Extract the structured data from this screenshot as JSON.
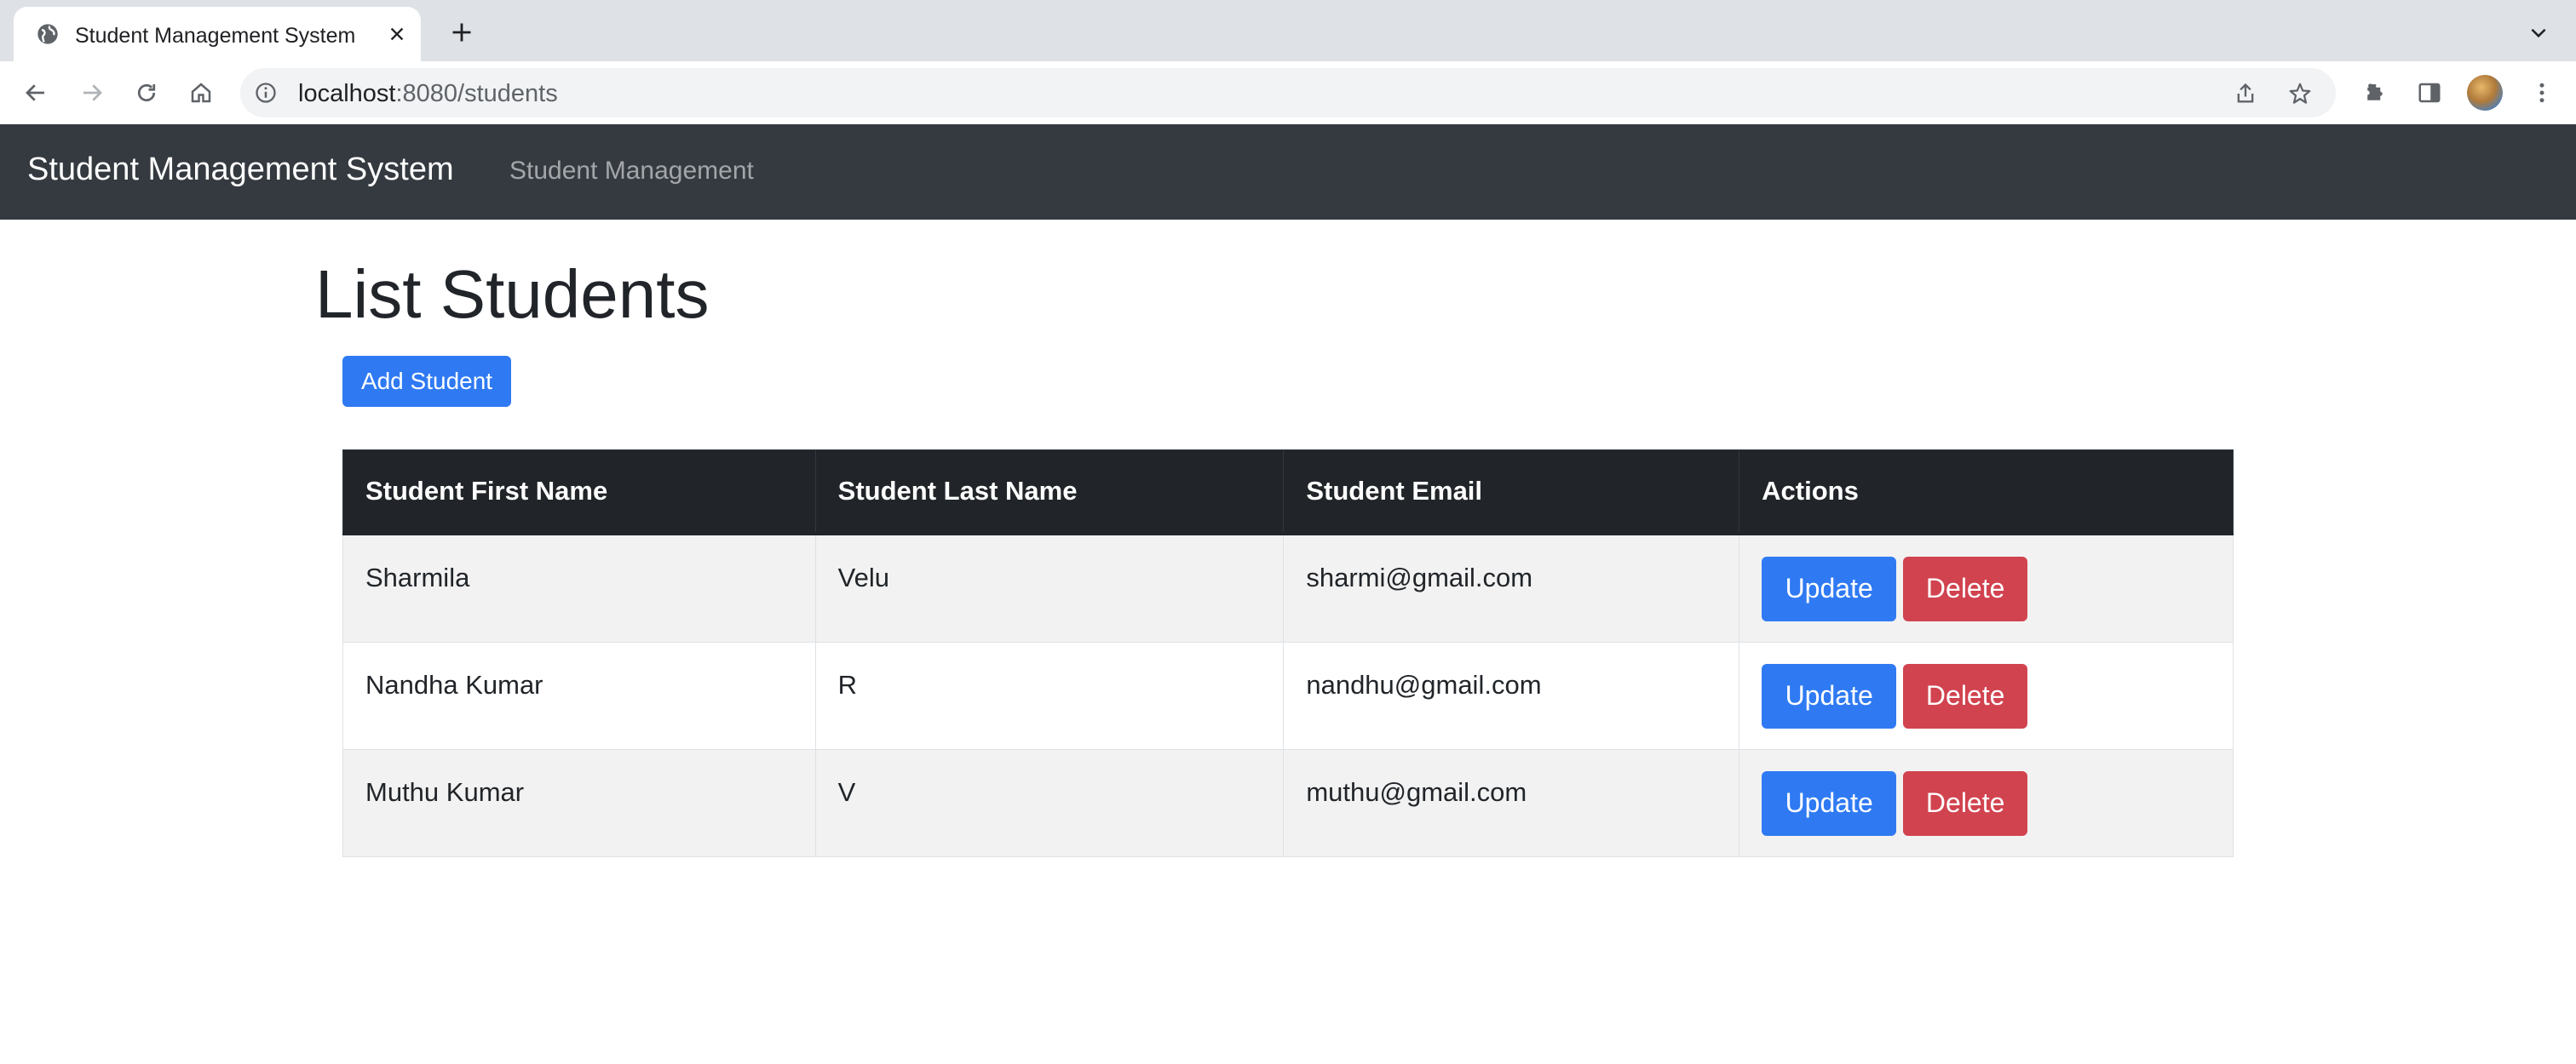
{
  "browser": {
    "tab_title": "Student Management System",
    "url_host": "localhost",
    "url_path": ":8080/students"
  },
  "navbar": {
    "brand": "Student Management System",
    "link": "Student Management"
  },
  "page": {
    "title": "List Students",
    "add_button": "Add Student"
  },
  "table": {
    "headers": [
      "Student First Name",
      "Student Last Name",
      "Student Email",
      "Actions"
    ],
    "rows": [
      {
        "first_name": "Sharmila",
        "last_name": "Velu",
        "email": "sharmi@gmail.com"
      },
      {
        "first_name": "Nandha Kumar",
        "last_name": "R",
        "email": "nandhu@gmail.com"
      },
      {
        "first_name": "Muthu Kumar",
        "last_name": "V",
        "email": "muthu@gmail.com"
      }
    ],
    "update_label": "Update",
    "delete_label": "Delete"
  },
  "colors": {
    "navbar_bg": "#343a40",
    "primary": "#2f7af3",
    "danger": "#d1434f",
    "table_header_bg": "#212529"
  },
  "icons": {
    "tab_favicon": "globe-icon",
    "tab_close": "close-icon",
    "new_tab": "plus-icon",
    "back": "back-arrow-icon",
    "forward": "forward-arrow-icon",
    "reload": "reload-icon",
    "home": "home-icon",
    "site_info": "info-icon",
    "share": "share-icon",
    "bookmark": "star-icon",
    "extensions": "puzzle-icon",
    "side_panel": "side-panel-icon",
    "menu": "kebab-menu-icon"
  }
}
